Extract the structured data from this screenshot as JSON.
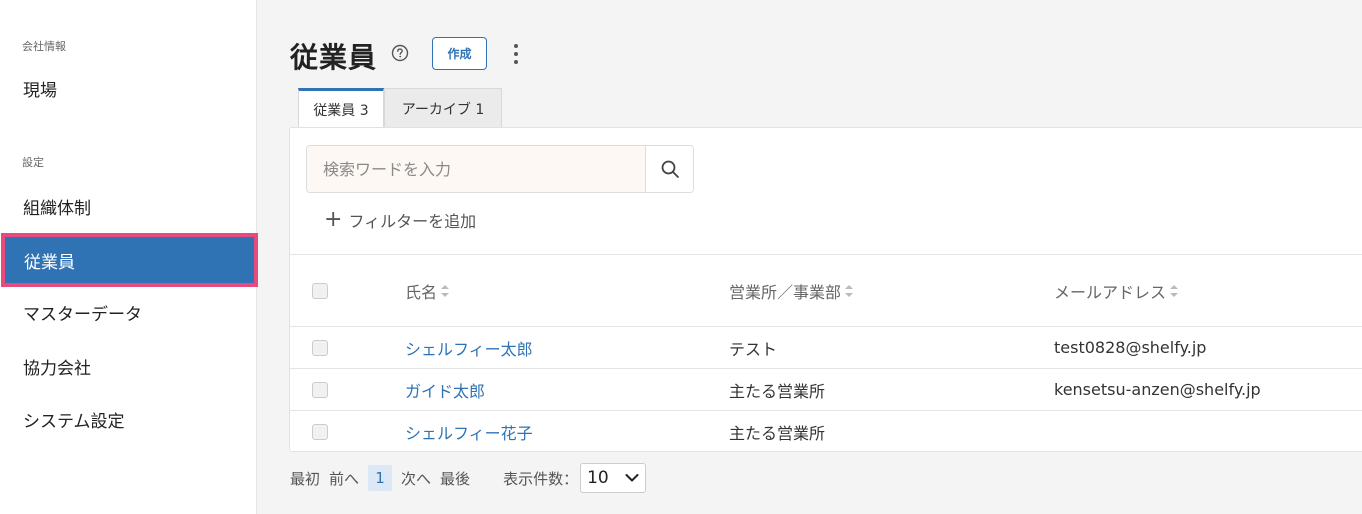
{
  "sidebar": {
    "section_company": "会社情報",
    "item_site": "現場",
    "section_settings": "設定",
    "item_org": "組織体制",
    "item_employees": "従業員",
    "item_master": "マスターデータ",
    "item_partners": "協力会社",
    "item_system": "システム設定"
  },
  "header": {
    "title": "従業員",
    "create_label": "作成"
  },
  "tabs": [
    {
      "label": "従業員 3"
    },
    {
      "label": "アーカイブ 1"
    }
  ],
  "search": {
    "placeholder": "検索ワードを入力",
    "value": ""
  },
  "filter": {
    "add_label": "フィルターを追加"
  },
  "table": {
    "headers": {
      "name": "氏名",
      "office": "営業所／事業部",
      "email": "メールアドレス"
    },
    "rows": [
      {
        "name": "シェルフィー太郎",
        "office": "テスト",
        "email": "test0828@shelfy.jp"
      },
      {
        "name": "ガイド太郎",
        "office": "主たる営業所",
        "email": "kensetsu-anzen@shelfy.jp"
      },
      {
        "name": "シェルフィー花子",
        "office": "主たる営業所",
        "email": ""
      }
    ]
  },
  "pagination": {
    "first": "最初",
    "prev": "前へ",
    "current": "1",
    "next": "次へ",
    "last": "最後",
    "per_page_label": "表示件数：",
    "per_page_value": "10"
  },
  "colors": {
    "accent": "#2f73b5",
    "highlight_border": "#e74a7c",
    "search_bg": "#fdf8f3"
  },
  "icons": {
    "help": "help-circle-icon",
    "more": "more-vertical-icon",
    "search": "search-icon",
    "plus": "plus-icon",
    "chevron": "chevron-down-icon",
    "sort": "sort-icon"
  }
}
